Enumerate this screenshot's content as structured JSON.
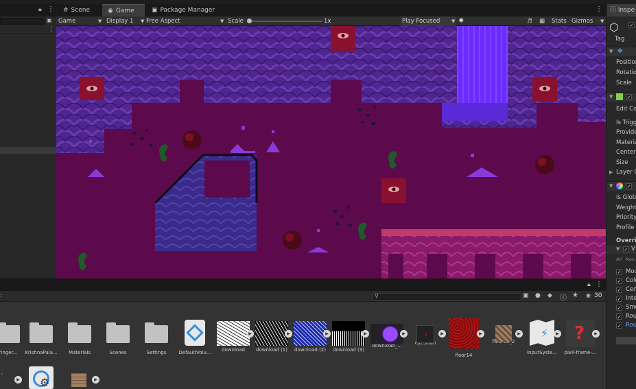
{
  "tabs": [
    {
      "label": "Scene",
      "icon": "grid-icon",
      "active": false
    },
    {
      "label": "Game",
      "icon": "gamepad-icon",
      "active": true
    },
    {
      "label": "Package Manager",
      "icon": "package-icon",
      "active": false
    }
  ],
  "inspector_tab": {
    "label": "Inspe"
  },
  "game_toolbar": {
    "view_mode": "Game",
    "display": "Display 1",
    "aspect": "Free Aspect",
    "scale_label": "Scale",
    "scale_value": "1x",
    "play_mode": "Play Focused",
    "stats": "Stats",
    "gizmos": "Gizmos"
  },
  "inspector": {
    "tag_label": "Tag",
    "transform": [
      "Position",
      "Rotation",
      "Scale"
    ],
    "collider": [
      "Edit Co",
      "Is Trigg",
      "Provide",
      "Materia",
      "Center",
      "Size",
      "Layer O"
    ],
    "volume": [
      "Is Globa",
      "Weight",
      "Priority",
      "Profile"
    ],
    "overrides_label": "Overri",
    "override_header": "V",
    "all_none": [
      "All",
      "Non"
    ],
    "override_items": [
      "Mod",
      "Colo",
      "Cen",
      "Inte",
      "Smo",
      "Rou",
      "Rou"
    ]
  },
  "project": {
    "hidden_count": "30",
    "assets_row1": [
      {
        "name": "ringer...",
        "kind": "folder"
      },
      {
        "name": "KrishnaPala...",
        "kind": "folder"
      },
      {
        "name": "Materials",
        "kind": "folder"
      },
      {
        "name": "Scenes",
        "kind": "folder"
      },
      {
        "name": "Settings",
        "kind": "folder"
      },
      {
        "name": "DefaultVolu...",
        "kind": "volume"
      },
      {
        "name": "download",
        "kind": "texture-white"
      },
      {
        "name": "download (1)",
        "kind": "texture-black"
      },
      {
        "name": "download (2)",
        "kind": "texture-blue"
      },
      {
        "name": "download (3)",
        "kind": "texture-bars"
      },
      {
        "name": "download_...",
        "kind": "texture-glow"
      },
      {
        "name": "eyeStain",
        "kind": "texture-dark"
      },
      {
        "name": "floor14",
        "kind": "texture-red"
      },
      {
        "name": "floor30_2",
        "kind": "texture-tile"
      },
      {
        "name": "InputSyste...",
        "kind": "input"
      },
      {
        "name": "pixil-frame-...",
        "kind": "texture-eye"
      }
    ]
  },
  "colors": {
    "panel": "#282828",
    "toolbar": "#2f2f2f",
    "project": "#333333",
    "game_bg": "#5a0a4a",
    "accent_blue": "#6b2bff"
  }
}
